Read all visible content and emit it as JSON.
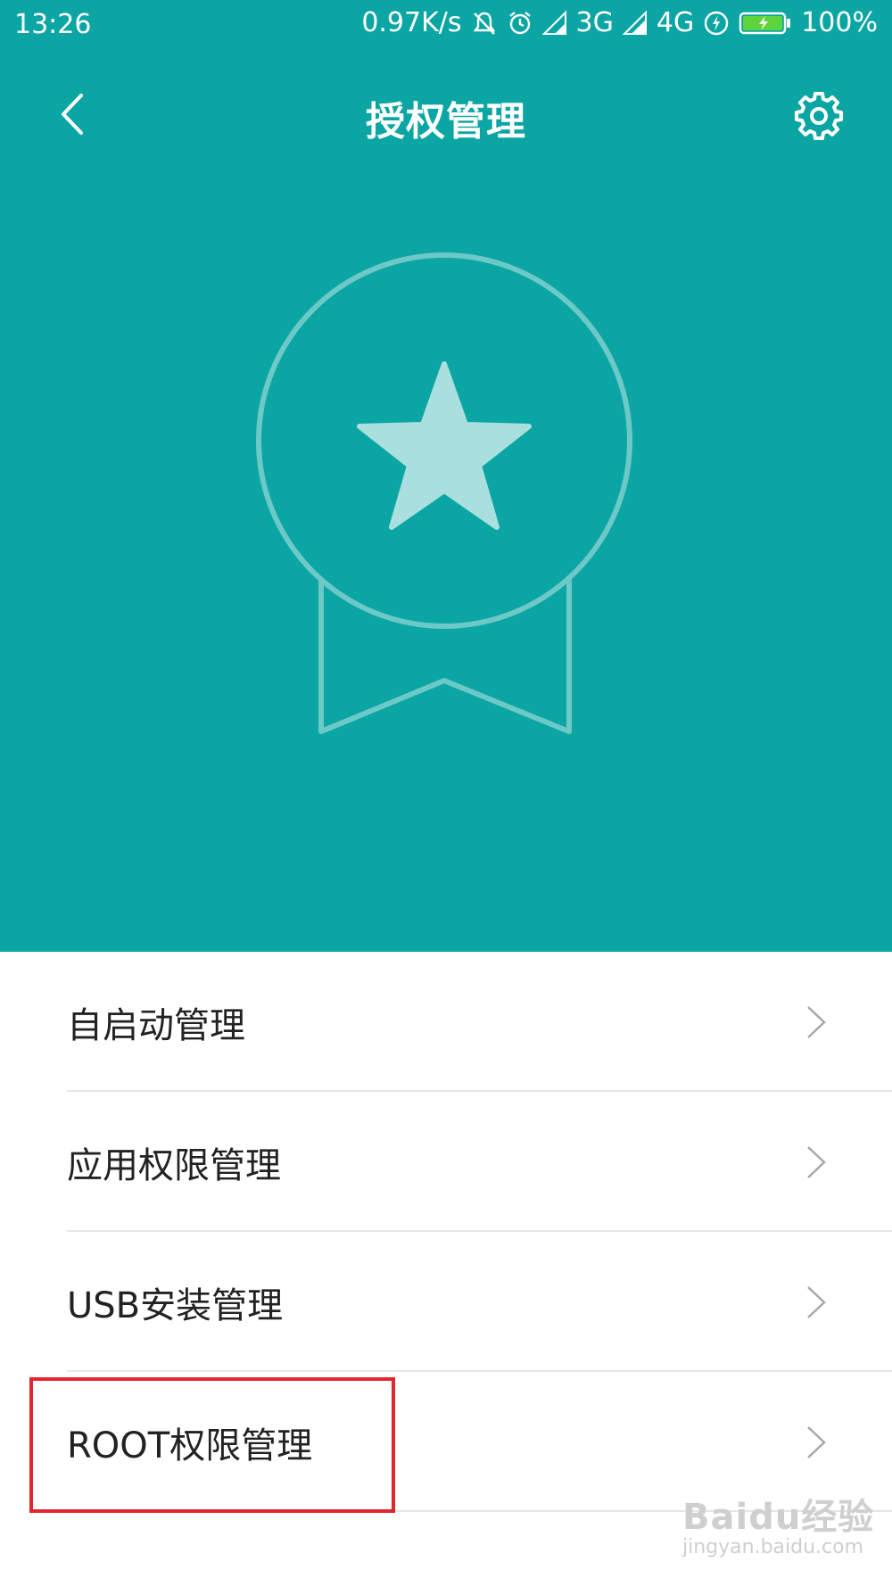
{
  "status_bar": {
    "time": "13:26",
    "net_speed": "0.97K/s",
    "network_1": "3G",
    "network_2": "4G",
    "battery": "100%",
    "icons": [
      "mute-icon",
      "alarm-icon",
      "signal-icon",
      "charging-icon",
      "battery-icon"
    ]
  },
  "header": {
    "title": "授权管理",
    "back_icon": "chevron-left-icon",
    "settings_icon": "gear-icon"
  },
  "colors": {
    "accent": "#0ba5a4",
    "illustration": "#a9e0df",
    "highlight": "#e3262e"
  },
  "menu": {
    "items": [
      {
        "label": "自启动管理"
      },
      {
        "label": "应用权限管理"
      },
      {
        "label": "USB安装管理"
      },
      {
        "label": "ROOT权限管理"
      }
    ]
  },
  "watermark": {
    "brand": "Baidu经验",
    "url": "jingyan.baidu.com"
  }
}
